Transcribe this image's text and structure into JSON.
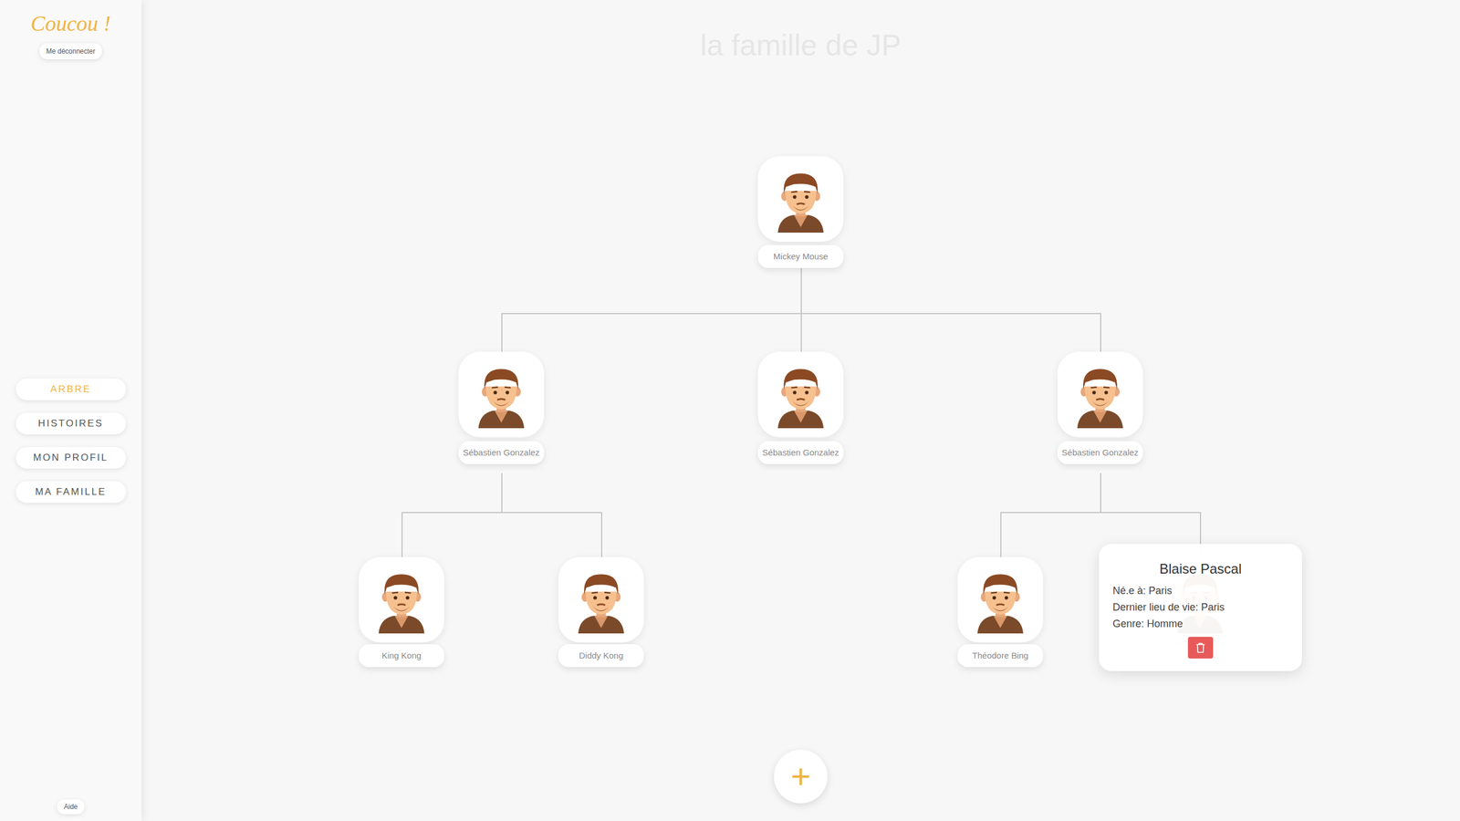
{
  "sidebar": {
    "logo": "Coucou !",
    "logout": "Me déconnecter",
    "items": [
      {
        "label": "ARBRE",
        "selected": true
      },
      {
        "label": "HISTOIRES",
        "selected": false
      },
      {
        "label": "MON PROFIL",
        "selected": false
      },
      {
        "label": "MA FAMILLE",
        "selected": false
      }
    ],
    "help": "Aide"
  },
  "title": "la famille de JP",
  "tree": {
    "name": "Mickey Mouse",
    "children": [
      {
        "name": "Sébastien Gonzalez",
        "children": [
          {
            "name": "King Kong",
            "children": []
          },
          {
            "name": "Diddy Kong",
            "children": []
          }
        ]
      },
      {
        "name": "Sébastien Gonzalez",
        "children": []
      },
      {
        "name": "Sébastien Gonzalez",
        "children": [
          {
            "name": "Théodore Bing",
            "children": []
          },
          {
            "details": {
              "title": "Blaise Pascal",
              "lines": [
                "Né.e à: Paris",
                "Dernier lieu de vie: Paris",
                "Genre: Homme"
              ]
            },
            "children": []
          }
        ]
      }
    ]
  },
  "add_button": "+"
}
